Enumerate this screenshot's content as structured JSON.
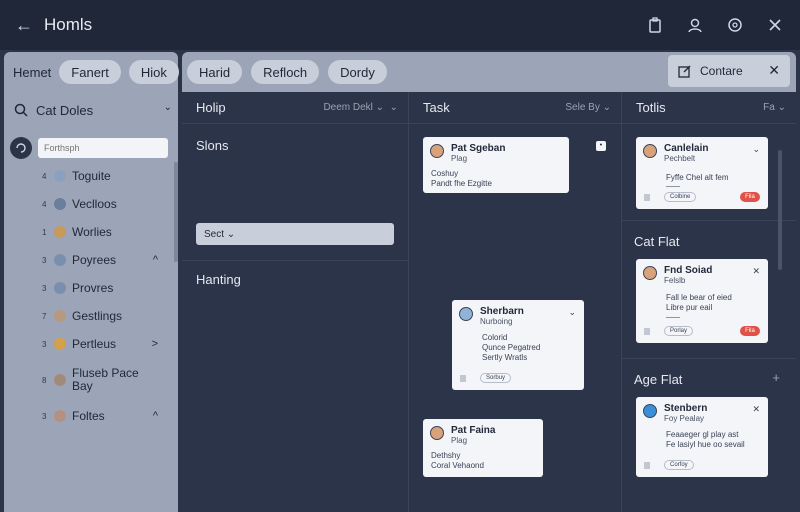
{
  "titlebar": {
    "title": "Homls"
  },
  "toolbar": {
    "left_label": "Hemet",
    "left_pills": [
      "Fanert",
      "Hiok"
    ],
    "right_pills": [
      "Harid",
      "Refloch",
      "Dordy"
    ],
    "context_button": "Contare"
  },
  "sidebar": {
    "search_label": "Cat Doles",
    "input_placeholder": "Forthsph",
    "items": [
      {
        "num": "4",
        "label": "Toguite",
        "color": "#8aa0c0"
      },
      {
        "num": "4",
        "label": "Veclloos",
        "color": "#6b7e9e"
      },
      {
        "num": "1",
        "label": "Worlies",
        "color": "#c79a5a"
      },
      {
        "num": "3",
        "label": "Poyrees",
        "color": "#7a8fb0",
        "caret": "^"
      },
      {
        "num": "3",
        "label": "Provres",
        "color": "#7a8fb0"
      },
      {
        "num": "7",
        "label": "Gestlings",
        "color": "#b59a80"
      },
      {
        "num": "3",
        "label": "Pertleus",
        "color": "#d4a04a",
        "caret": ">"
      },
      {
        "num": "8",
        "label": "Fluseb Pace\nBay",
        "color": "#a08a7a"
      },
      {
        "num": "3",
        "label": "Foltes",
        "color": "#b59080",
        "caret": "^"
      }
    ]
  },
  "columns": {
    "col1": {
      "title": "Holip",
      "control": "Deem Dekl",
      "section1": "Slons",
      "select_label": "Sect",
      "section2": "Hanting"
    },
    "col2": {
      "title": "Task",
      "control": "Sele By"
    },
    "col3": {
      "title": "Totlis",
      "control": "Fa",
      "section2": "Cat Flat",
      "section3": "Age Flat"
    }
  },
  "cards": {
    "c1": {
      "name": "Pat Sgeban",
      "sub": "Plag",
      "line1": "Coshuy",
      "line2": "Pandt fhe Ezgitte"
    },
    "c2": {
      "name": "Sherbarn",
      "sub": "Nurboing",
      "line1": "Colorid",
      "line2": "Qunce Pegatred",
      "line3": "Sertly Wratls",
      "tag": "Sorbuy"
    },
    "c3": {
      "name": "Pat Faina",
      "sub": "Plag",
      "line1": "Dethshy",
      "line2": "Coral Vehaond"
    },
    "c4": {
      "name": "Canlelain",
      "sub": "Pechbelt",
      "line1": "Fyffe Chel alt fem",
      "tag": "Colbine",
      "badge": "Fila"
    },
    "c5": {
      "name": "Fnd Soiad",
      "sub": "Felslb",
      "line1": "Fall le bear of eied",
      "line2": "Libre pur eail",
      "tag": "Porlay",
      "badge": "Fila"
    },
    "c6": {
      "name": "Stenbern",
      "sub": "Foy Pealay",
      "line1": "Feaaeger gl play ast",
      "line2": "Fe lasiyl hue oo sevail",
      "tag": "Corfoy"
    }
  }
}
